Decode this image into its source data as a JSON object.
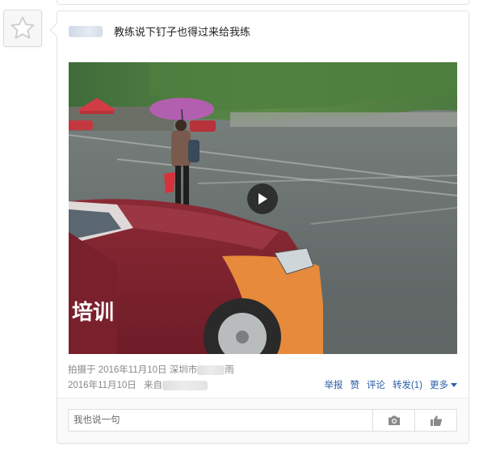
{
  "post": {
    "text": "教练说下钉子也得过来给我练"
  },
  "video": {
    "play_icon": "play-icon",
    "car_lettering": "培训"
  },
  "meta": {
    "shot_prefix": "拍摄于",
    "shot_date": "2016年11月10日",
    "city_prefix": "深圳市",
    "weather": "雨",
    "post_date": "2016年11月10日",
    "source_prefix": "来自"
  },
  "actions": {
    "report": "举报",
    "like": "赞",
    "comment": "评论",
    "share": "转发(1)",
    "more": "更多"
  },
  "comment": {
    "placeholder": "我也说一句",
    "camera_icon": "camera-icon",
    "thumb_icon": "thumbs-up-icon"
  },
  "colors": {
    "link": "#2a5fa7",
    "meta": "#888888"
  }
}
